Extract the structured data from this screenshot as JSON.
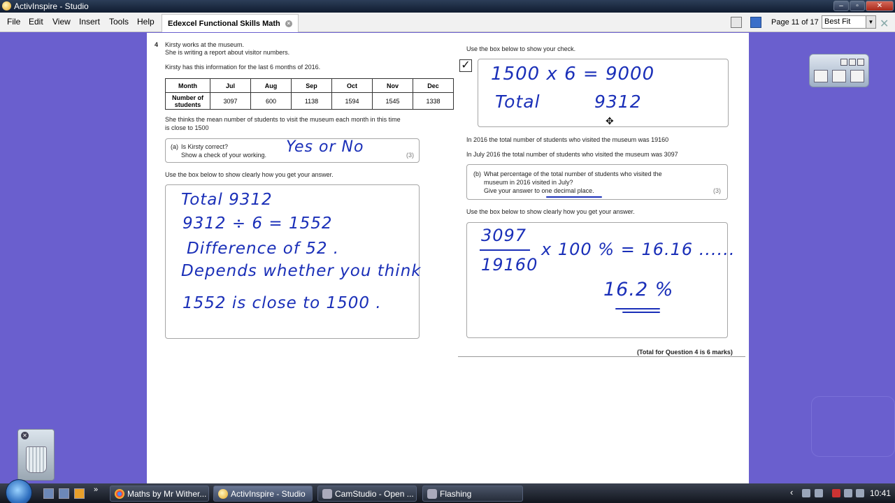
{
  "window": {
    "title": "ActivInspire - Studio"
  },
  "menu": {
    "items": [
      "File",
      "Edit",
      "View",
      "Insert",
      "Tools",
      "Help"
    ]
  },
  "tab": {
    "label": "Edexcel Functional Skills Math",
    "close": "×"
  },
  "toolbar": {
    "page_indicator": "Page 11 of 17",
    "zoom": "Best Fit"
  },
  "question": {
    "number": "4",
    "intro1": "Kirsty works at the museum.",
    "intro2": "She is writing a report about visitor numbers.",
    "info": "Kirsty has this information for the last 6 months of 2016.",
    "table": {
      "header_label": "Month",
      "months": [
        "Jul",
        "Aug",
        "Sep",
        "Oct",
        "Nov",
        "Dec"
      ],
      "row_label_1": "Number of",
      "row_label_2": "students",
      "values": [
        "3097",
        "600",
        "1138",
        "1594",
        "1545",
        "1338"
      ]
    },
    "claim1": "She thinks the mean number of students to visit the museum each month in this time",
    "claim2": "is close to 1500",
    "part_a": {
      "label": "(a)",
      "line1": "Is Kirsty correct?",
      "line2": "Show a check of your working.",
      "marks": "(3)"
    },
    "box_instruction_a": "Use the box below to show clearly how you get your answer.",
    "check_instruction": "Use the box below to show your check.",
    "total_2016": "In 2016 the total number of students who visited the museum was 19160",
    "total_july": "In July 2016 the total number of students who visited the museum was 3097",
    "part_b": {
      "label": "(b)",
      "line1": "What percentage of the total number of students who visited the",
      "line2": "museum in 2016 visited in July?",
      "line3_pre": "Give your answer to ",
      "line3_ul": "one decimal place",
      "line3_post": ".",
      "marks": "(3)"
    },
    "box_instruction_b": "Use the box below to show clearly how you get your answer.",
    "total_marks": "(Total for Question 4 is 6 marks)"
  },
  "handwriting": {
    "yes_or_no": "Yes or No",
    "a_line1": "Total   9312",
    "a_line2": "9312 ÷ 6 = 1552",
    "a_line3": "Difference of 52 .",
    "a_line4": "Depends whether you think",
    "a_line5": "1552 is close to 1500 .",
    "check_line1": "1500 x 6 = 9000",
    "check_total": "Total",
    "check_value": "9312",
    "b_num": "3097",
    "b_den": "19160",
    "b_expr": "x 100 %   = 16.16 ......",
    "b_answer": "16.2 %"
  },
  "taskbar": {
    "tasks": [
      "Maths by Mr Wither...",
      "ActivInspire - Studio",
      "CamStudio - Open ...",
      "Flashing"
    ],
    "clock": "10:41"
  }
}
